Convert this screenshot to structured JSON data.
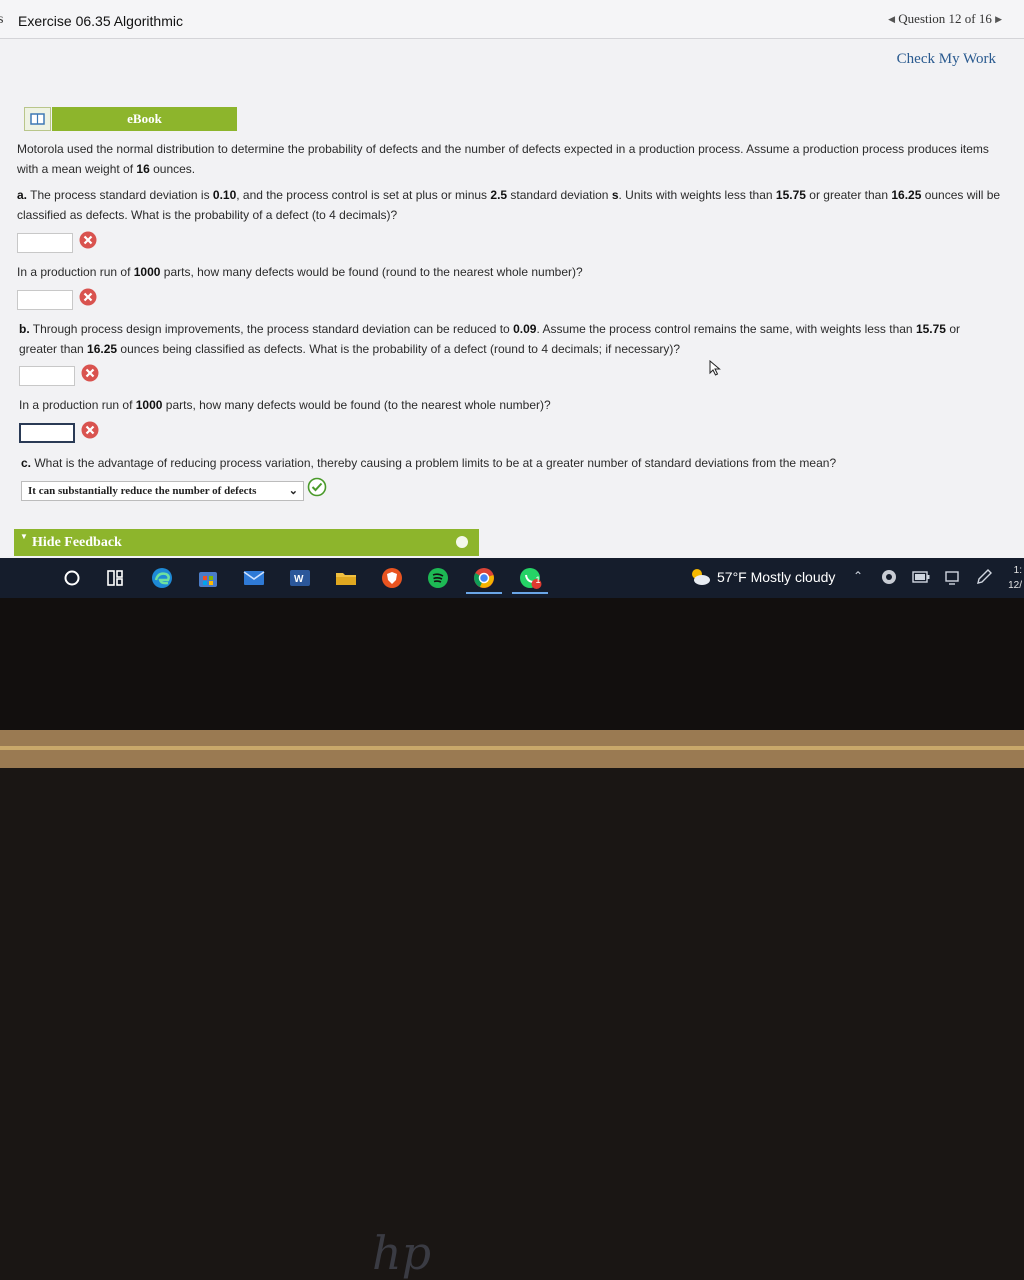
{
  "header": {
    "left_edge_char": "s",
    "title": "Exercise 06.35 Algorithmic",
    "question_prev": "◀",
    "question_nav": "Question 12 of 16",
    "question_next": "▶"
  },
  "check_my_work": "Check My Work",
  "ebook": {
    "label": "eBook"
  },
  "intro": {
    "t1": "Motorola used the normal distribution to determine the probability of defects and the number of defects expected in a production process. Assume a production process produces items with a mean weight of ",
    "mean": "16",
    "t2": " ounces."
  },
  "part_a": {
    "letter": "a.",
    "t1": " The process standard deviation is ",
    "sd": "0.10",
    "t2": ", and the process control is set at plus or minus ",
    "k": "2.5",
    "t3": " standard deviation ",
    "s": "s",
    "t4": ". Units with weights less than ",
    "low": "15.75",
    "t5": " or greater than ",
    "high": "16.25",
    "t6": " ounces will be classified as defects. What is the probability of a defect (to 4 decimals)?",
    "q2_t1": "In a production run of ",
    "q2_n": "1000",
    "q2_t2": " parts, how many defects would be found (round to the nearest whole number)?"
  },
  "part_b": {
    "letter": "b.",
    "t1": " Through process design improvements, the process standard deviation can be reduced to ",
    "sd": "0.09",
    "t2": ". Assume the process control remains the same, with weights less than ",
    "low": "15.75",
    "t3": " or greater than ",
    "high": "16.25",
    "t4": " ounces being classified as defects. What is the probability of a defect (round to 4 decimals; if necessary)?",
    "q2_t1": "In a production run of ",
    "q2_n": "1000",
    "q2_t2": " parts, how many defects would be found (to the nearest whole number)?"
  },
  "part_c": {
    "letter": "c.",
    "t1": " What is the advantage of reducing process variation, thereby causing a problem limits to be at a greater number of standard deviations from the mean?",
    "selected": "It can substantially reduce the number of defects"
  },
  "feedback": {
    "label": "Hide Feedback"
  },
  "taskbar": {
    "weather": "57°F  Mostly cloudy",
    "chrome_badge": "1",
    "clock_time": "1:",
    "clock_date": "12/"
  },
  "colors": {
    "accent_green": "#8db52c",
    "error_red": "#d9534f",
    "link_blue": "#2a5a8f",
    "taskbar": "#151d2c"
  },
  "icons": [
    "book-icon",
    "error-x-icon",
    "correct-check-icon",
    "start-icon",
    "task-view-icon",
    "edge-icon",
    "store-icon",
    "mail-icon",
    "word-icon",
    "file-explorer-icon",
    "vpn-shield-icon",
    "spotify-icon",
    "chrome-icon",
    "whatsapp-icon",
    "weather-icon"
  ]
}
